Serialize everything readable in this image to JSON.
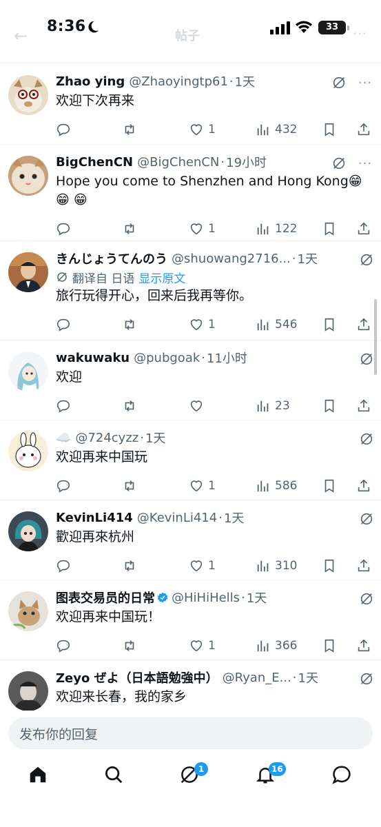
{
  "status_bar": {
    "time": "8:36",
    "battery": "33",
    "faint_title": "帖子"
  },
  "replies": [
    {
      "name": "Zhao ying",
      "handle": "@Zhaoyingtp61",
      "time": "1天",
      "text": "欢迎下次再来",
      "likes": "1",
      "views": "432",
      "avatar_color": "#d9c6a8"
    },
    {
      "name": "BigChenCN",
      "handle": "@BigChenCN",
      "time": "19小时",
      "text": "Hope you come to Shenzhen and Hong Kong😁 😁 😁",
      "likes": "1",
      "views": "122",
      "avatar_color": "#d8b48e"
    },
    {
      "name": "きんじょうてんのう",
      "handle": "@shuowang2716...",
      "time": "1天",
      "translated_label": "翻译自 日语",
      "show_original": "显示原文",
      "text": "旅行玩得开心，回来后我再等你。",
      "likes": "1",
      "views": "546",
      "avatar_color": "#a86b3f"
    },
    {
      "name": "wakuwaku",
      "handle": "@pubgoak",
      "time": "11小时",
      "text": "欢迎",
      "likes": "",
      "views": "23",
      "avatar_color": "#cfe3ea"
    },
    {
      "name": "☁️",
      "handle": "@724cyzz",
      "time": "1天",
      "text": "欢迎再来中国玩",
      "likes": "1",
      "views": "586",
      "avatar_color": "#f5ecd2"
    },
    {
      "name": "KevinLi414",
      "handle": "@KevinLi414",
      "time": "1天",
      "text": "歡迎再來杭州",
      "likes": "1",
      "views": "310",
      "avatar_color": "#5d6f7a"
    },
    {
      "name": "图表交易员的日常",
      "handle": "@HiHiHells",
      "time": "1天",
      "text": "欢迎再来中国玩！",
      "likes": "1",
      "views": "366",
      "verified": true,
      "avatar_color": "#c9a27a"
    },
    {
      "name": "Zeyo ぜよ（日本語勉強中）",
      "handle": "@Ryan_E...",
      "time": "1天",
      "text": "欢迎来长春，我的家乡",
      "likes": "",
      "views": "",
      "avatar_color": "#6b6b6b"
    }
  ],
  "compose": {
    "placeholder": "发布你的回复"
  },
  "bottom_nav": {
    "grok_badge": "1",
    "notifications_badge": "16"
  },
  "colors": {
    "accent": "#1d9bf0",
    "secondary_text": "#536471",
    "divider": "#eff3f4"
  }
}
